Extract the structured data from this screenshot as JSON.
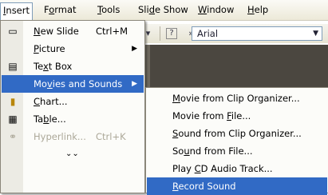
{
  "menubar": {
    "items": [
      {
        "label": "Insert"
      },
      {
        "label": "Format"
      },
      {
        "label": "Tools"
      },
      {
        "label": "Slide Show"
      },
      {
        "label": "Window"
      },
      {
        "label": "Help"
      }
    ]
  },
  "toolbar": {
    "font_value": "Arial"
  },
  "insert_menu": {
    "items": [
      {
        "label": "New Slide",
        "shortcut": "Ctrl+M"
      },
      {
        "label": "Picture"
      },
      {
        "label": "Text Box"
      },
      {
        "label": "Movies and Sounds"
      },
      {
        "label": "Chart..."
      },
      {
        "label": "Table..."
      },
      {
        "label": "Hyperlink...",
        "shortcut": "Ctrl+K"
      }
    ]
  },
  "movies_submenu": {
    "items": [
      {
        "label": "Movie from Clip Organizer..."
      },
      {
        "label": "Movie from File..."
      },
      {
        "label": "Sound from Clip Organizer..."
      },
      {
        "label": "Sound from File..."
      },
      {
        "label": "Play CD Audio Track..."
      },
      {
        "label": "Record Sound"
      }
    ]
  },
  "colors": {
    "highlight": "#316ac5",
    "menu_bg": "#fcfcf9",
    "workspace": "#4b4740"
  }
}
